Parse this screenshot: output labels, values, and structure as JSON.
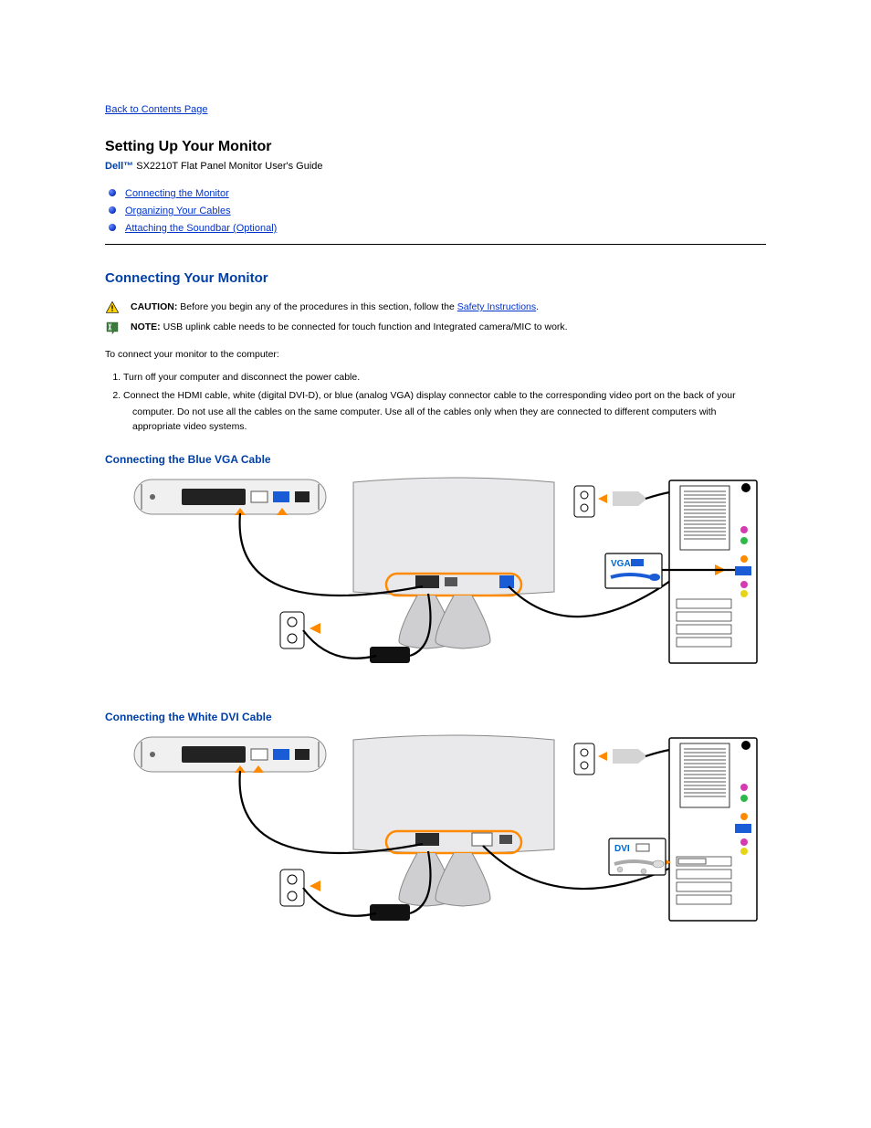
{
  "back_link": "Back to Contents Page",
  "doc_title": "Setting Up Your Monitor",
  "subtitle_brand": "Dell™",
  "subtitle_rest": " SX2210T Flat Panel Monitor User's Guide",
  "toc": [
    "Connecting the Monitor",
    "Organizing Your Cables",
    "Attaching the Soundbar (Optional)"
  ],
  "section": {
    "heading": "Connecting Your Monitor",
    "caution_label": "CAUTION:",
    "caution_text_pre": " Before you begin any of the procedures in this section, follow the ",
    "caution_link": "Safety Instructions",
    "caution_text_post": ".",
    "note_label": "NOTE:",
    "note_text": " USB uplink cable needs to be connected for touch function and Integrated camera/MIC to work.",
    "intro": "To connect your monitor to the computer:",
    "step1": "Turn off your computer and disconnect the power cable.",
    "step2_pre": "Connect the HDMI cable, white (digital DVI-D), or blue (analog VGA) display connector cable to the corresponding video port on the back of your ",
    "step2_post": "computer. Do not use all the cables on the same computer.",
    "step2_tail": " Use all of the cables only when they are connected to different computers with appropriate video systems.",
    "sub1": "Connecting the Blue VGA Cable",
    "sub2": "Connecting the White DVI Cable",
    "vga_label": "VGA",
    "dvi_label": "DVI"
  }
}
